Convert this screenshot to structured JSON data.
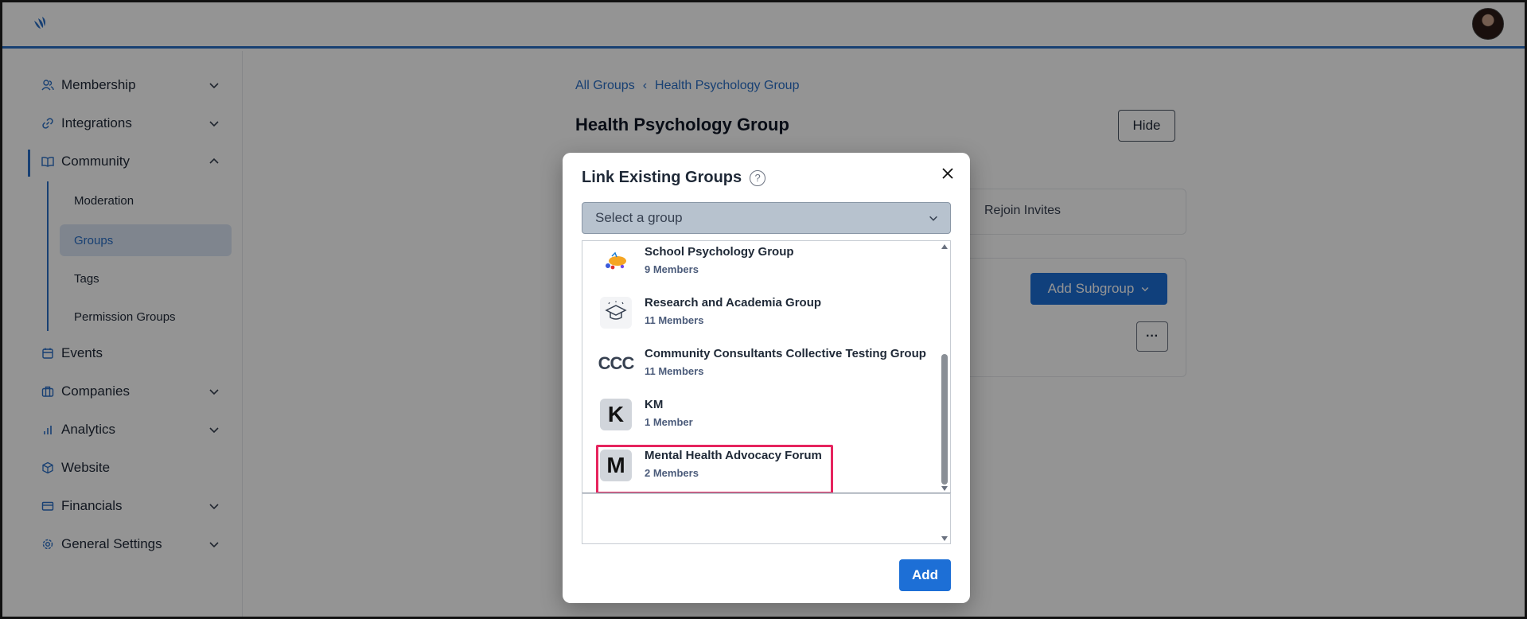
{
  "sidebar": {
    "items": [
      {
        "label": "Membership",
        "icon": "users-icon",
        "expandable": true
      },
      {
        "label": "Integrations",
        "icon": "link-icon",
        "expandable": true
      },
      {
        "label": "Community",
        "icon": "book-icon",
        "expandable": true,
        "expanded": true
      },
      {
        "label": "Events",
        "icon": "calendar-icon",
        "expandable": false
      },
      {
        "label": "Companies",
        "icon": "briefcase-icon",
        "expandable": true
      },
      {
        "label": "Analytics",
        "icon": "bar-chart-icon",
        "expandable": true
      },
      {
        "label": "Website",
        "icon": "cube-icon",
        "expandable": false
      },
      {
        "label": "Financials",
        "icon": "card-icon",
        "expandable": true
      },
      {
        "label": "General Settings",
        "icon": "gear-icon",
        "expandable": true
      }
    ],
    "community_sub": [
      "Moderation",
      "Groups",
      "Tags",
      "Permission Groups"
    ]
  },
  "main": {
    "breadcrumb_root": "All Groups",
    "breadcrumb_current": "Health Psychology Group",
    "title": "Health Psychology Group",
    "hide_label": "Hide",
    "tab_rejoin": "Rejoin Invites",
    "add_subgroup_label": "Add Subgroup",
    "more_label": "···"
  },
  "modal": {
    "title": "Link Existing Groups",
    "select_placeholder": "Select a group",
    "groups": [
      {
        "name": "School Psychology Group",
        "members": "9 Members",
        "icon": "school-logo-icon"
      },
      {
        "name": "Research and Academia Group",
        "members": "11 Members",
        "icon": "graduation-cap-icon"
      },
      {
        "name": "Community Consultants Collective Testing Group",
        "members": "11 Members",
        "icon": "ccc-logo-icon",
        "logo_text": "CCC"
      },
      {
        "name": "KM",
        "members": "1 Member",
        "icon": "letter-avatar-icon",
        "letter": "K"
      },
      {
        "name": "Mental Health Advocacy Forum",
        "members": "2 Members",
        "icon": "letter-avatar-icon",
        "letter": "M"
      }
    ],
    "add_label": "Add"
  },
  "colors": {
    "accent": "#1d6fd6",
    "highlight": "#e6245e"
  }
}
